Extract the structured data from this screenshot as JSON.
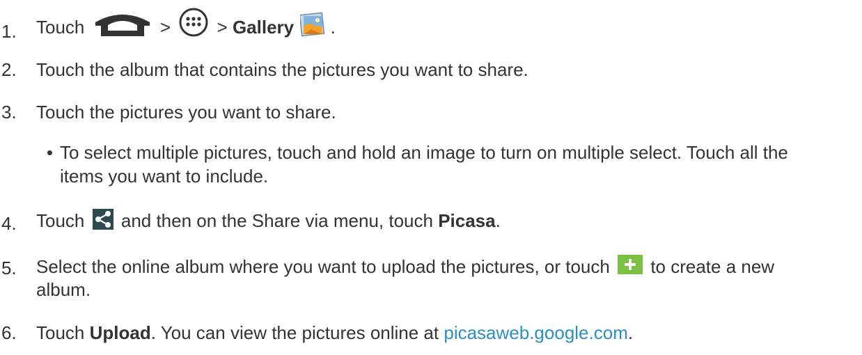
{
  "steps": [
    {
      "num": "1.",
      "touch": "Touch",
      "gt1": ">",
      "gt2": ">",
      "gallery": "Gallery",
      "period": "."
    },
    {
      "num": "2.",
      "text": "Touch the album that contains the pictures you want to share."
    },
    {
      "num": "3.",
      "text": "Touch the pictures you want to share."
    },
    {
      "num": "4.",
      "touch": "Touch",
      "mid": "and then on the Share via menu, touch",
      "picasa": "Picasa",
      "period": "."
    },
    {
      "num": "5.",
      "pre": "Select the online album where you want to upload the pictures, or touch",
      "post": "to create a new",
      "line2": "album."
    },
    {
      "num": "6.",
      "touch": "Touch",
      "upload": "Upload",
      "mid": ". You can view the pictures online at",
      "link": "picasaweb.google.com",
      "period": "."
    }
  ],
  "bullet": {
    "line1": "To select multiple pictures, touch and hold an image to turn on multiple select. Touch all the",
    "line2": "items you want to include."
  },
  "icons": {
    "home": "home-icon",
    "apps": "apps-icon",
    "gallery": "gallery-icon",
    "share": "share-icon",
    "add": "add-icon"
  },
  "colors": {
    "text": "#333333",
    "link": "#2a8fc7",
    "add_bg": "#7bc142",
    "share_bg": "#2d4b4f"
  }
}
